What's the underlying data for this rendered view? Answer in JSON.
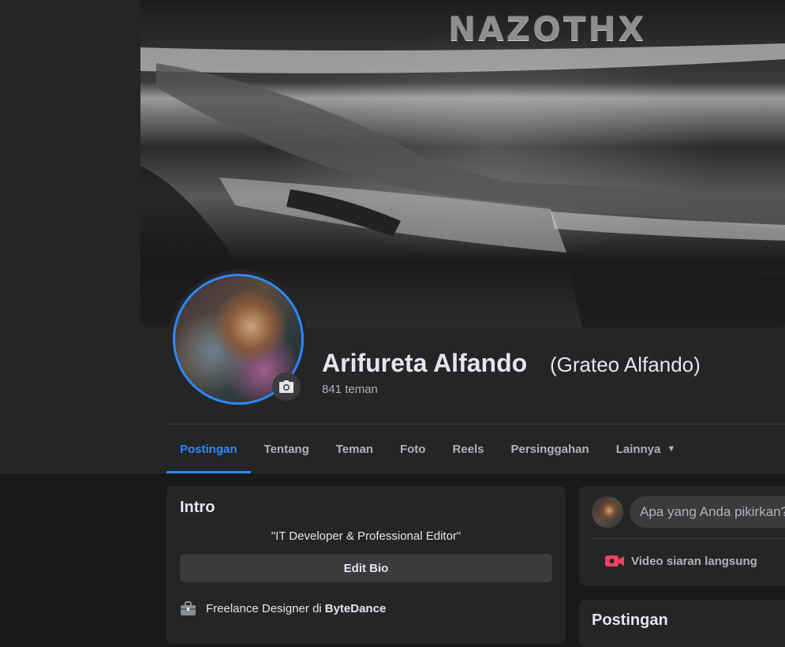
{
  "cover": {
    "brand_text": "NAZOTHX"
  },
  "profile": {
    "name": "Arifureta Alfando",
    "alternate_name": "(Grateo Alfando)",
    "friends": "841 teman"
  },
  "tabs": [
    {
      "label": "Postingan",
      "active": true
    },
    {
      "label": "Tentang",
      "active": false
    },
    {
      "label": "Teman",
      "active": false
    },
    {
      "label": "Foto",
      "active": false
    },
    {
      "label": "Reels",
      "active": false
    },
    {
      "label": "Persinggahan",
      "active": false
    },
    {
      "label": "Lainnya",
      "active": false,
      "dropdown": true
    }
  ],
  "intro": {
    "title": "Intro",
    "bio": "\"IT Developer & Professional Editor\"",
    "edit_bio_label": "Edit Bio",
    "work": {
      "prefix": "Freelance Designer di",
      "company": "ByteDance",
      "icon": "briefcase-icon"
    }
  },
  "composer": {
    "placeholder": "Apa yang Anda pikirkan?",
    "live_video_label": "Video siaran langsung",
    "live_icon": "video-camera-icon"
  },
  "posts": {
    "title": "Postingan"
  },
  "colors": {
    "accent": "#2d88ff",
    "background": "#18191a",
    "card": "#242526",
    "live_icon": "#f3425f"
  }
}
